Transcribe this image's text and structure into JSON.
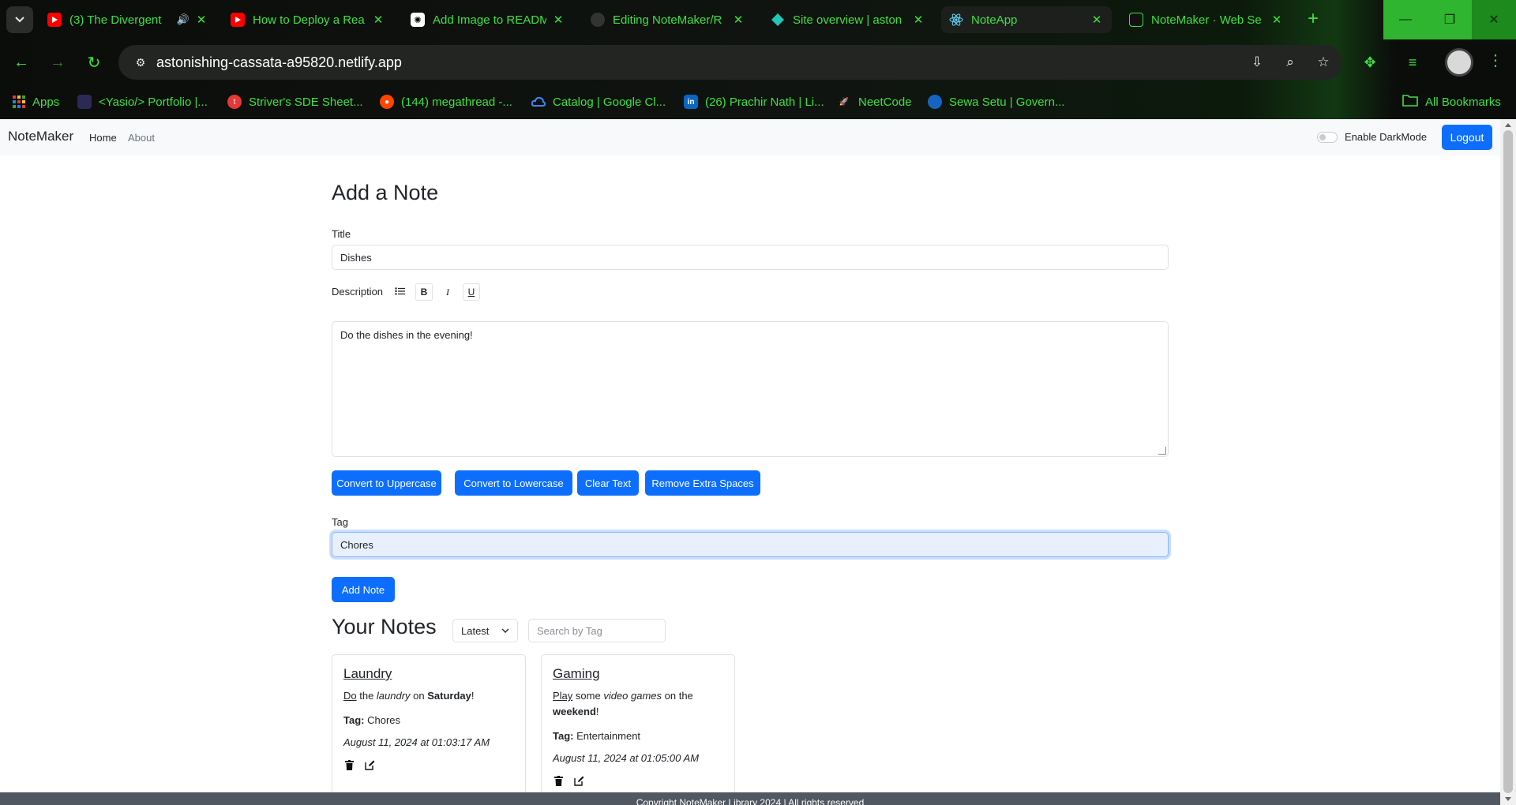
{
  "browser": {
    "tabs": [
      {
        "title": "(3) The Divergent",
        "favicon": "youtube-icon",
        "audio": true
      },
      {
        "title": "How to Deploy a Rea",
        "favicon": "youtube-icon"
      },
      {
        "title": "Add Image to READM",
        "favicon": "openai-icon"
      },
      {
        "title": "Editing NoteMaker/R",
        "favicon": "github-icon"
      },
      {
        "title": "Site overview | aston",
        "favicon": "netlify-icon"
      },
      {
        "title": "NoteApp",
        "favicon": "react-icon",
        "active": true
      },
      {
        "title": "NoteMaker · Web Se",
        "favicon": "render-icon"
      }
    ],
    "url": "astonishing-cassata-a95820.netlify.app",
    "bookmarks": [
      {
        "label": "Apps",
        "icon": "apps-grid-icon"
      },
      {
        "label": "<Yasio/> Portfolio |...",
        "icon": "portfolio-icon"
      },
      {
        "label": "Striver's SDE Sheet...",
        "icon": "tuf-icon"
      },
      {
        "label": "(144) megathread -...",
        "icon": "reddit-icon"
      },
      {
        "label": "Catalog | Google Cl...",
        "icon": "google-cloud-icon"
      },
      {
        "label": "(26) Prachir Nath | Li...",
        "icon": "linkedin-icon"
      },
      {
        "label": "NeetCode",
        "icon": "rocket-icon"
      },
      {
        "label": "Sewa Setu | Govern...",
        "icon": "emblem-icon"
      }
    ],
    "all_bookmarks": "All Bookmarks",
    "accent": "#3ee23e"
  },
  "app": {
    "brand": "NoteMaker",
    "nav": {
      "home": "Home",
      "about": "About"
    },
    "darkmode_label": "Enable DarkMode",
    "logout": "Logout",
    "primary_color": "#0d6efd"
  },
  "form": {
    "heading": "Add a Note",
    "title_label": "Title",
    "title_value": "Dishes",
    "description_label": "Description",
    "description_value": "Do the dishes in the evening!",
    "buttons": {
      "uppercase": "Convert to Uppercase",
      "lowercase": "Convert to Lowercase",
      "clear": "Clear Text",
      "spaces": "Remove Extra Spaces"
    },
    "tag_label": "Tag",
    "tag_value": "Chores",
    "submit": "Add Note"
  },
  "notes": {
    "heading": "Your Notes",
    "sort_value": "Latest",
    "search_placeholder": "Search by Tag",
    "tag_prefix": "Tag:",
    "items": [
      {
        "title": "Laundry",
        "desc": {
          "w1": "Do",
          "w2": " the ",
          "w3": "laundry",
          "w4": " on ",
          "w5": "Saturday",
          "w6": "!"
        },
        "tag": "Chores",
        "date": "August 11, 2024 at 01:03:17 AM"
      },
      {
        "title": "Gaming",
        "desc": {
          "w1": "Play",
          "w2": " some ",
          "w3": "video games",
          "w4": " on the ",
          "w5": "weekend",
          "w6": "!"
        },
        "tag": "Entertainment",
        "date": "August 11, 2024 at 01:05:00 AM"
      }
    ]
  },
  "footer": "Copyright NoteMaker Library 2024 | All rights reserved"
}
